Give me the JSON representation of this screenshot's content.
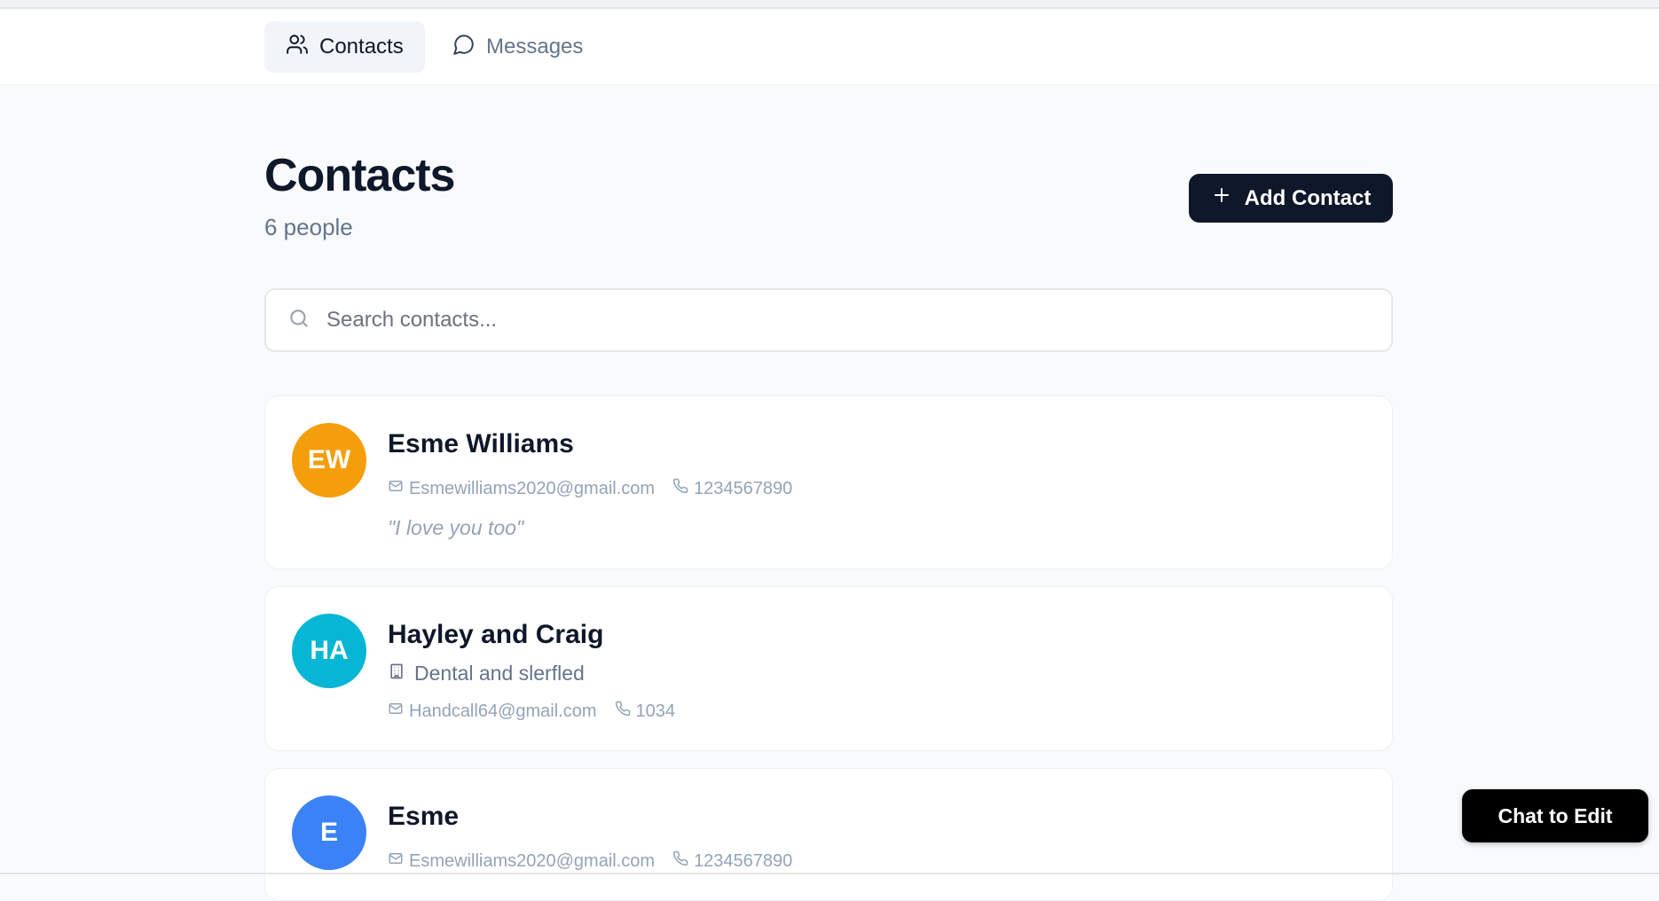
{
  "nav": {
    "tabs": [
      {
        "label": "Contacts",
        "icon": "users-icon",
        "active": true
      },
      {
        "label": "Messages",
        "icon": "message-circle-icon",
        "active": false
      }
    ]
  },
  "header": {
    "title": "Contacts",
    "count": "6 people",
    "add_label": "Add Contact"
  },
  "search": {
    "placeholder": "Search contacts...",
    "value": ""
  },
  "contacts": [
    {
      "initials": "EW",
      "avatar_color": "#f59e0b",
      "name": "Esme Williams",
      "email": "Esmewilliams2020@gmail.com",
      "phone": "1234567890",
      "note": "\"I love you too\""
    },
    {
      "initials": "HA",
      "avatar_color": "#06b6d4",
      "name": "Hayley and Craig",
      "company": "Dental and slerfled",
      "email": "Handcall64@gmail.com",
      "phone": "1034"
    },
    {
      "initials": "E",
      "avatar_color": "#3b82f6",
      "name": "Esme",
      "email": "Esmewilliams2020@gmail.com",
      "phone": "1234567890"
    }
  ],
  "chat_button": {
    "label": "Chat to Edit"
  },
  "colors": {
    "primary": "#0f172a",
    "muted": "#64748b",
    "background": "#f8fafc"
  }
}
